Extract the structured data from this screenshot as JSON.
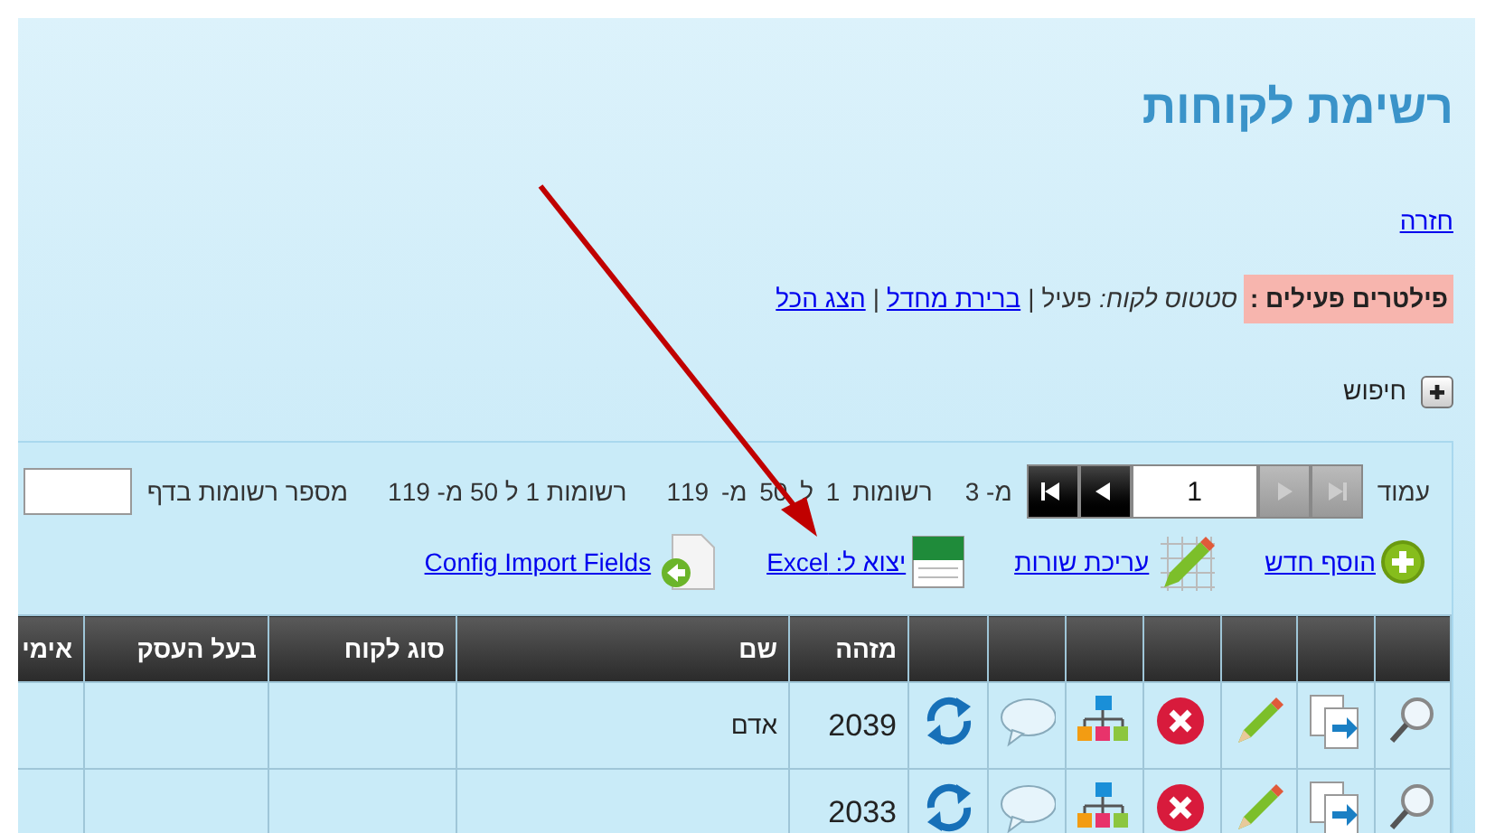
{
  "title": "רשימת לקוחות",
  "back_link": "חזרה",
  "filters": {
    "label": "פילטרים פעילים :",
    "status_label": "סטטוס לקוח:",
    "status_value": "פעיל",
    "separator": "|",
    "links": [
      "ברירת מחדל",
      "הצג הכל"
    ]
  },
  "search": {
    "label": "חיפוש",
    "expanded": false
  },
  "pager": {
    "page_label": "עמוד",
    "page": "1",
    "prev_enabled": true,
    "next_enabled": false,
    "of": "מ- 3",
    "range_1": "רשומות 1 ל 50 מ- 119",
    "range_2": "רשומות 1 ל 50 מ- 119",
    "per_page_label": "מספר רשומות בדף"
  },
  "toolbar": [
    {
      "kind": "add",
      "label": "הוסף חדש"
    },
    {
      "kind": "edit-rows",
      "label": "עריכת שורות"
    },
    {
      "kind": "excel",
      "label": "יצוא ל: Excel"
    },
    {
      "kind": "import",
      "label": "Config Import Fields"
    }
  ],
  "table": {
    "columns": [
      "מזהה",
      "שם",
      "סוג לקוח",
      "בעל העסק",
      "אימי"
    ],
    "rows": [
      {
        "id": "2039",
        "name": "אדם"
      },
      {
        "id": "2033"
      }
    ]
  }
}
